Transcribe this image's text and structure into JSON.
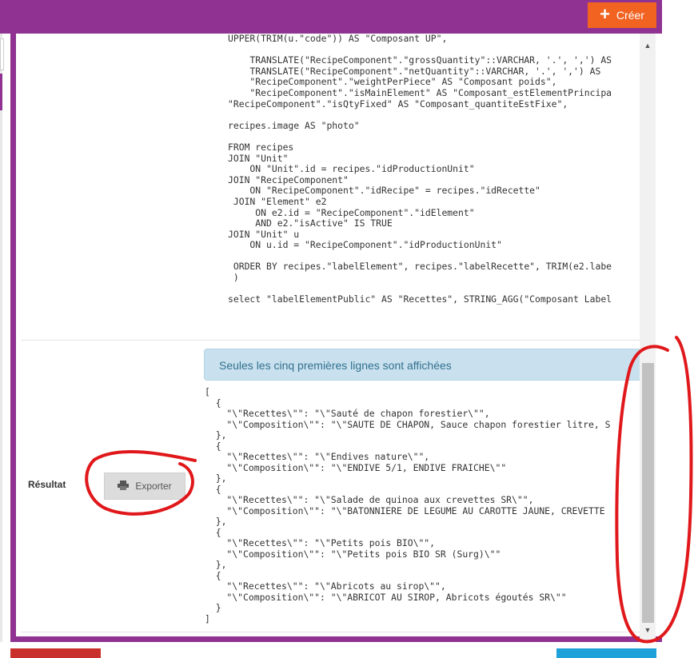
{
  "header": {
    "create_label": "Créer"
  },
  "query": {
    "lines": [
      "UPPER(TRIM(u.\"code\")) AS \"Composant UP\",",
      "",
      "    TRANSLATE(\"RecipeComponent\".\"grossQuantity\"::VARCHAR, '.', ',') AS",
      "    TRANSLATE(\"RecipeComponent\".\"netQuantity\"::VARCHAR, '.', ',') AS",
      "    \"RecipeComponent\".\"weightPerPiece\" AS \"Composant poids\",",
      "    \"RecipeComponent\".\"isMainElement\" AS \"Composant_estElementPrincipa",
      "\"RecipeComponent\".\"isQtyFixed\" AS \"Composant_quantiteEstFixe\",",
      "",
      "recipes.image AS \"photo\"",
      "",
      "FROM recipes",
      "JOIN \"Unit\"",
      "    ON \"Unit\".id = recipes.\"idProductionUnit\"",
      "JOIN \"RecipeComponent\"",
      "    ON \"RecipeComponent\".\"idRecipe\" = recipes.\"idRecette\"",
      " JOIN \"Element\" e2",
      "     ON e2.id = \"RecipeComponent\".\"idElement\"",
      "     AND e2.\"isActive\" IS TRUE",
      "JOIN \"Unit\" u",
      "    ON u.id = \"RecipeComponent\".\"idProductionUnit\"",
      "",
      " ORDER BY recipes.\"labelElement\", recipes.\"labelRecette\", TRIM(e2.labe",
      " )",
      "",
      "select \"labelElementPublic\" AS \"Recettes\", STRING_AGG(\"Composant Label"
    ]
  },
  "result": {
    "label": "Résultat",
    "export_label": "Exporter",
    "info_message": "Seules les cinq premières lignes sont affichées",
    "json_lines": [
      "[",
      "  {",
      "    \"\\\"Recettes\\\"\": \"\\\"Sauté de chapon forestier\\\"\",",
      "    \"\\\"Composition\\\"\": \"\\\"SAUTE DE CHAPON, Sauce chapon forestier litre, S",
      "  },",
      "  {",
      "    \"\\\"Recettes\\\"\": \"\\\"Endives nature\\\"\",",
      "    \"\\\"Composition\\\"\": \"\\\"ENDIVE 5/1, ENDIVE FRAICHE\\\"\"",
      "  },",
      "  {",
      "    \"\\\"Recettes\\\"\": \"\\\"Salade de quinoa aux crevettes SR\\\"\",",
      "    \"\\\"Composition\\\"\": \"\\\"BATONNIERE DE LEGUME AU CAROTTE JAUNE, CREVETTE",
      "  },",
      "  {",
      "    \"\\\"Recettes\\\"\": \"\\\"Petits pois BIO\\\"\",",
      "    \"\\\"Composition\\\"\": \"\\\"Petits pois BIO SR (Surg)\\\"\"",
      "  },",
      "  {",
      "    \"\\\"Recettes\\\"\": \"\\\"Abricots au sirop\\\"\",",
      "    \"\\\"Composition\\\"\": \"\\\"ABRICOT AU SIROP, Abricots égoutés SR\\\"\"",
      "  }",
      "]"
    ]
  },
  "icons": {
    "plus": "plus-icon",
    "export": "printer-icon",
    "scroll_up": "arrow-up-icon",
    "scroll_down": "arrow-down-icon"
  },
  "colors": {
    "brand": "#8f3291",
    "create_button": "#f26322",
    "info_bg": "#c9e1ee",
    "info_text": "#31708f",
    "annotation": "#e0181b"
  }
}
